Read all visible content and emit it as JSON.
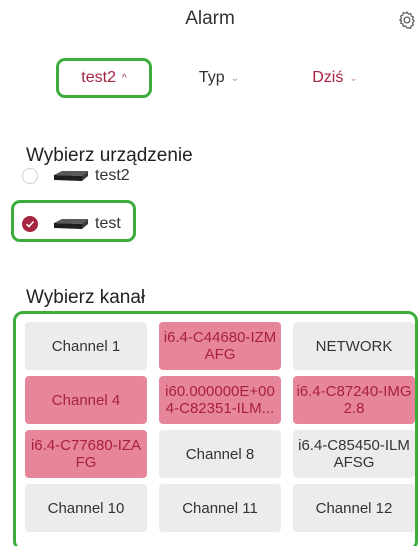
{
  "header": {
    "title": "Alarm",
    "settings_icon": "gear-icon"
  },
  "filters": {
    "device": {
      "label": "test2",
      "chevron": "^"
    },
    "type": {
      "label": "Typ",
      "chevron": "⌄"
    },
    "date": {
      "label": "Dziś",
      "chevron": "⌄"
    }
  },
  "device_section": {
    "title": "Wybierz urządzenie",
    "devices": [
      {
        "name": "test2",
        "checked": false
      },
      {
        "name": "test",
        "checked": true
      }
    ]
  },
  "channel_section": {
    "title": "Wybierz kanał",
    "channels": [
      {
        "label": "Channel 1",
        "active": false
      },
      {
        "label": "i6.4-C44680-IZMAFG",
        "active": true
      },
      {
        "label": "NETWORK",
        "active": false
      },
      {
        "label": "Channel 4",
        "active": true
      },
      {
        "label": "i60.000000E+004-C82351-ILM...",
        "active": true
      },
      {
        "label": "i6.4-C87240-IMG2.8",
        "active": true
      },
      {
        "label": "i6.4-C77680-IZAFG",
        "active": true
      },
      {
        "label": "Channel 8",
        "active": false
      },
      {
        "label": "i6.4-C85450-ILMAFSG",
        "active": false
      },
      {
        "label": "Channel 10",
        "active": false
      },
      {
        "label": "Channel 11",
        "active": false
      },
      {
        "label": "Channel 12",
        "active": false
      }
    ]
  },
  "colors": {
    "accent": "#a5243f",
    "active_tile": "#e7859a",
    "tile": "#ececec",
    "highlight": "#3cac3c"
  }
}
